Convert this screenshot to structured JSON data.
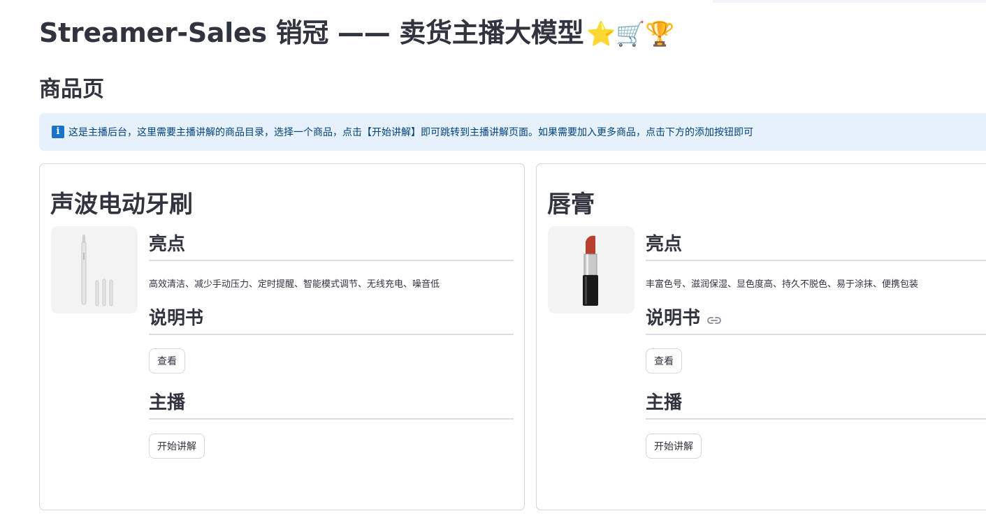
{
  "header": {
    "title": "Streamer-Sales 销冠 —— 卖货主播大模型",
    "title_emojis": "⭐🛒🏆"
  },
  "page": {
    "heading": "商品页",
    "info_icon": "i",
    "info_text": "这是主播后台，这里需要主播讲解的商品目录，选择一个商品，点击【开始讲解】即可跳转到主播讲解页面。如果需要加入更多商品，点击下方的添加按钮即可"
  },
  "products": [
    {
      "name": "声波电动牙刷",
      "image": "electric-toothbrush",
      "highlights_heading": "亮点",
      "highlights": "高效清洁、减少手动压力、定时提醒、智能模式调节、无线充电、噪音低",
      "manual_heading": "说明书",
      "manual_button": "查看",
      "streamer_heading": "主播",
      "start_button": "开始讲解"
    },
    {
      "name": "唇膏",
      "image": "lipstick",
      "highlights_heading": "亮点",
      "highlights": "丰富色号、滋润保湿、显色度高、持久不脱色、易于涂抹、便携包装",
      "manual_heading": "说明书",
      "manual_button": "查看",
      "streamer_heading": "主播",
      "start_button": "开始讲解"
    }
  ],
  "icons": {
    "info": "info-icon",
    "link": "link-icon"
  },
  "colors": {
    "info_bg": "#e6f1fb",
    "info_text": "#004280",
    "text": "#31333f",
    "border": "#d6d6d9"
  }
}
